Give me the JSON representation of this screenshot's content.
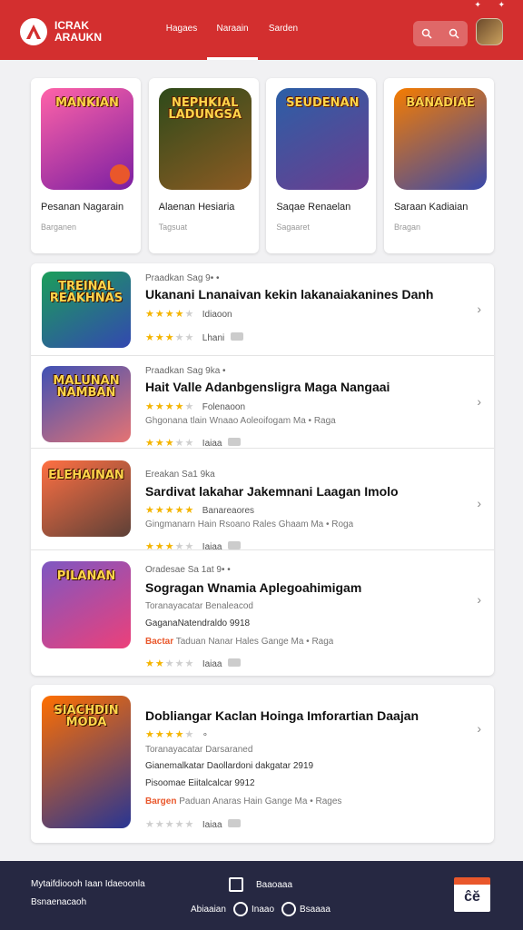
{
  "header": {
    "logo_text": "ICRAK ARAUKN",
    "nav": [
      "Hagaes",
      "Naraain",
      "Sarden"
    ],
    "active_nav": 1,
    "accent_color": "#d32f2f"
  },
  "featured": [
    {
      "art_title": "MANKIAN",
      "name": "Pesanan Nagarain",
      "sub": "Barganen",
      "colors": [
        "#ff63a8",
        "#7b1fa2"
      ]
    },
    {
      "art_title": "NEPHKIAL LADUNGSA",
      "name": "Alaenan Hesiaria",
      "sub": "Tagsuat",
      "colors": [
        "#2e4a1a",
        "#8d5b23"
      ]
    },
    {
      "art_title": "SEUDENAN",
      "name": "Saqae Renaelan",
      "sub": "Sagaaret",
      "colors": [
        "#2b5fa6",
        "#6d3d8f"
      ]
    },
    {
      "art_title": "BANADIAE",
      "name": "Saraan Kadiaian",
      "sub": "Bragan",
      "colors": [
        "#f57c00",
        "#3949ab"
      ]
    }
  ],
  "list": [
    {
      "art_title": "TREINAL REAKHNAS",
      "eyebrow": "Praadkan Sag 9• •",
      "title": "Ukanani Lnanaivan kekin lakanaiakanines Danh",
      "line3_stars": 4,
      "line3_note": "Idiaoon",
      "meta": "",
      "line5_stars": 3,
      "line5_note": "Lhani",
      "colors": [
        "#1b9e5a",
        "#3348b0"
      ]
    },
    {
      "art_title": "MALUNAN NAMBAN",
      "eyebrow": "Praadkan Sag 9ka •",
      "title": "Hait Valle Adanbgensligra Maga Nangaai",
      "line3_stars": 4,
      "line3_note": "Folenaoon",
      "meta": "Ghgonana tlain Wnaao Aoleoifogam Ma • Raga",
      "line5_stars": 3,
      "line5_note": "Iaiaa",
      "colors": [
        "#3f51b5",
        "#e57373"
      ]
    },
    {
      "art_title": "ELEHAINAN",
      "eyebrow": "Ereakan Sa1 9ka",
      "title": "Sardivat lakahar Jakemnani Laagan Imolo",
      "line3_stars": 5,
      "line3_note": "Banareaores",
      "meta": "Gingmanarn Hain Rsoano Rales Ghaam Ma • Roga",
      "line5_stars": 3,
      "line5_note": "Iaiaa",
      "colors": [
        "#ff7043",
        "#5d4037"
      ]
    },
    {
      "art_title": "PILANAN",
      "eyebrow": "Oradesae Sa 1at 9• •",
      "title": "Sogragan Wnamia Aplegoahimigam",
      "line3_note": "Toranayacatar Benaleacod",
      "meta": "GaganaNatendraldo 9918",
      "meta_accent": "Bactar",
      "meta2": "Taduan Nanar Hales Gange Ma • Raga",
      "line5_stars": 2,
      "line5_note": "Iaiaa",
      "colors": [
        "#7e57c2",
        "#ec407a"
      ]
    },
    {
      "art_title": "SIACHDIN MODA",
      "eyebrow": "",
      "title": "Dobliangar Kaclan Hoinga Imforartian Daajan",
      "line3_stars": 4,
      "line3_note": "∘",
      "meta": "Toranayacatar Darsaraned",
      "meta_b": "Gianemalkatar Daollardoni dakgatar 2919",
      "meta_c": "Pisoomae Eiitalcalcar 9912",
      "meta_accent": "Bargen",
      "meta2": "Paduan Anaras Hain Gange Ma • Rages",
      "line5_stars": 0,
      "line5_note": "Iaiaa",
      "colors": [
        "#ff6f00",
        "#283593"
      ]
    }
  ],
  "bottom": {
    "left_line1": "Mytaifdioooh Iaan Idaeoonla",
    "left_line2": "Bsnaenacaoh",
    "center_top": "Baaoaaa",
    "center_b1": "Abiaaian",
    "center_b2": "Inaao",
    "center_b3": "Bsaaaa",
    "brand_text": "ĉĕ"
  }
}
